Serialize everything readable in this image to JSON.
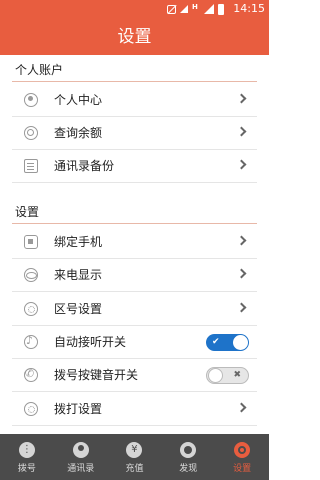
{
  "status_bar": {
    "time": "14:15",
    "network_label": "H"
  },
  "header": {
    "title": "设置"
  },
  "sections": [
    {
      "title": "个人账户",
      "items": [
        {
          "label": "个人中心",
          "icon": "user-icon",
          "control": "chevron"
        },
        {
          "label": "查询余额",
          "icon": "search-icon",
          "control": "chevron"
        },
        {
          "label": "通讯录备份",
          "icon": "document-icon",
          "control": "chevron"
        }
      ]
    },
    {
      "title": "设置",
      "items": [
        {
          "label": "绑定手机",
          "icon": "phone-icon",
          "control": "chevron"
        },
        {
          "label": "来电显示",
          "icon": "eye-icon",
          "control": "chevron"
        },
        {
          "label": "区号设置",
          "icon": "gear-icon",
          "control": "chevron"
        },
        {
          "label": "自动接听开关",
          "icon": "music-note-icon",
          "control": "toggle",
          "checked": true,
          "toggle_mark": "✔"
        },
        {
          "label": "拨号按键音开关",
          "icon": "handset-icon",
          "control": "toggle",
          "checked": false,
          "toggle_mark": "✖"
        },
        {
          "label": "拨打设置",
          "icon": "gear-icon",
          "control": "chevron"
        }
      ]
    }
  ],
  "bottom_nav": [
    {
      "label": "拨号",
      "icon": "dialpad-icon",
      "active": false
    },
    {
      "label": "通讯录",
      "icon": "contacts-icon",
      "active": false
    },
    {
      "label": "充值",
      "icon": "recharge-icon",
      "active": false
    },
    {
      "label": "发现",
      "icon": "discover-icon",
      "active": false
    },
    {
      "label": "设置",
      "icon": "settings-icon",
      "active": true
    }
  ],
  "colors": {
    "accent": "#e85d3f",
    "toggle_on": "#1e73c9",
    "nav_background": "#4b4b4b"
  }
}
